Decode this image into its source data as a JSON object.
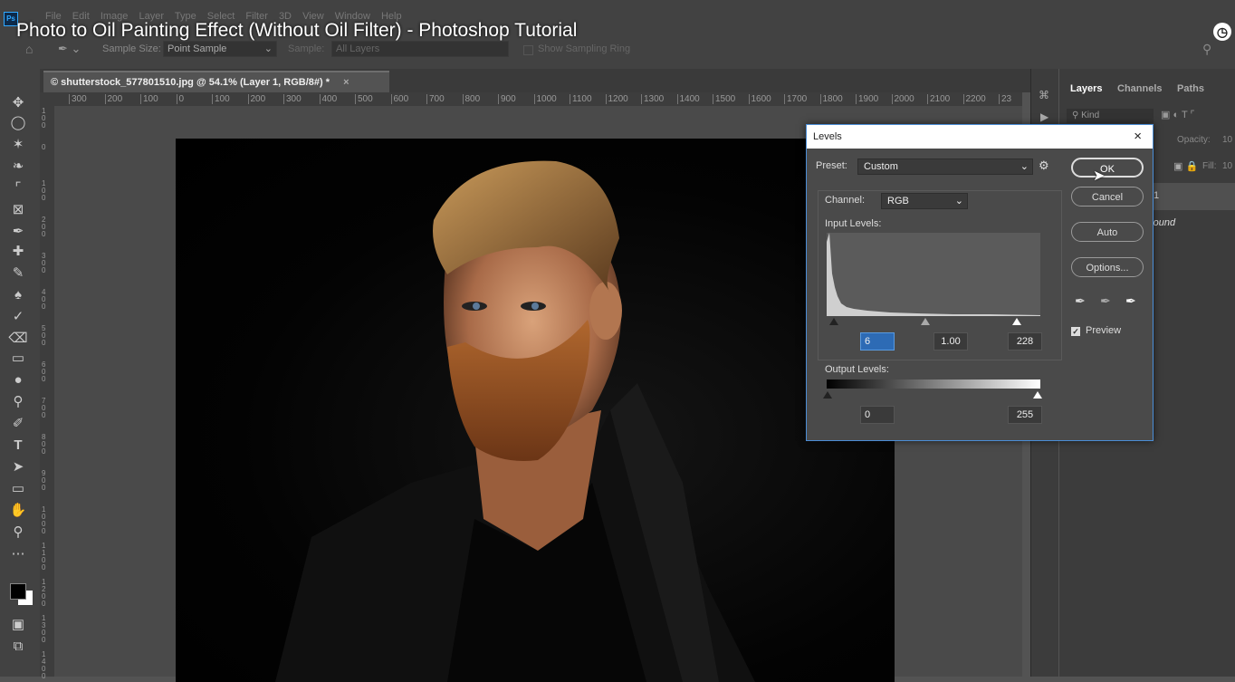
{
  "app": {
    "video_title": "Photo to Oil Painting Effect (Without Oil Filter) - Photoshop Tutorial",
    "menu": [
      "File",
      "Edit",
      "Image",
      "Layer",
      "Type",
      "Select",
      "Filter",
      "3D",
      "View",
      "Window",
      "Help"
    ],
    "logo": "Ps"
  },
  "options_bar": {
    "sample_size_label": "Sample Size:",
    "sample_size_value": "Point Sample",
    "sample_label": "Sample:",
    "sample_value": "All Layers",
    "sampling_ring": "Show Sampling Ring"
  },
  "document": {
    "tab_title": "© shutterstock_577801510.jpg @ 54.1% (Layer 1, RGB/8#) *",
    "tab_close": "×",
    "ruler_ticks": [
      "300",
      "200",
      "100",
      "0",
      "100",
      "200",
      "300",
      "400",
      "500",
      "600",
      "700",
      "800",
      "900",
      "1000",
      "1100",
      "1200",
      "1300",
      "1400",
      "1500",
      "1600",
      "1700",
      "1800",
      "1900",
      "2000",
      "2100",
      "2200",
      "23"
    ],
    "vruler_ticks": [
      "1\n0\n0",
      "0",
      "1\n0\n0",
      "2\n0\n0",
      "3\n0\n0",
      "4\n0\n0",
      "5\n0\n0",
      "6\n0\n0",
      "7\n0\n0",
      "8\n0\n0",
      "9\n0\n0",
      "1\n0\n0\n0",
      "1\n1\n0\n0",
      "1\n2\n0\n0",
      "1\n3\n0\n0",
      "1\n4\n0\n0"
    ]
  },
  "layers_panel": {
    "tabs": [
      "Layers",
      "Channels",
      "Paths"
    ],
    "kind_placeholder": "Kind",
    "opacity_label": "Opacity:",
    "opacity_value": "10",
    "fill_label": "Fill:",
    "fill_value": "10",
    "layer1": "1",
    "background": "round"
  },
  "levels_dialog": {
    "title": "Levels",
    "close": "×",
    "preset_label": "Preset:",
    "preset_value": "Custom",
    "channel_label": "Channel:",
    "channel_value": "RGB",
    "input_levels_label": "Input Levels:",
    "input_black": "6",
    "input_gamma": "1.00",
    "input_white": "228",
    "output_levels_label": "Output Levels:",
    "output_black": "0",
    "output_white": "255",
    "buttons": {
      "ok": "OK",
      "cancel": "Cancel",
      "auto": "Auto",
      "options": "Options..."
    },
    "preview_label": "Preview",
    "preview_checked": true
  },
  "colors": {
    "ui_dark": "#424242",
    "canvas_bg": "#4a4a4a",
    "dialog_bg": "#4a4a4a",
    "accent_blue": "#4b8dd6",
    "input_highlight": "#2d6bb5"
  }
}
